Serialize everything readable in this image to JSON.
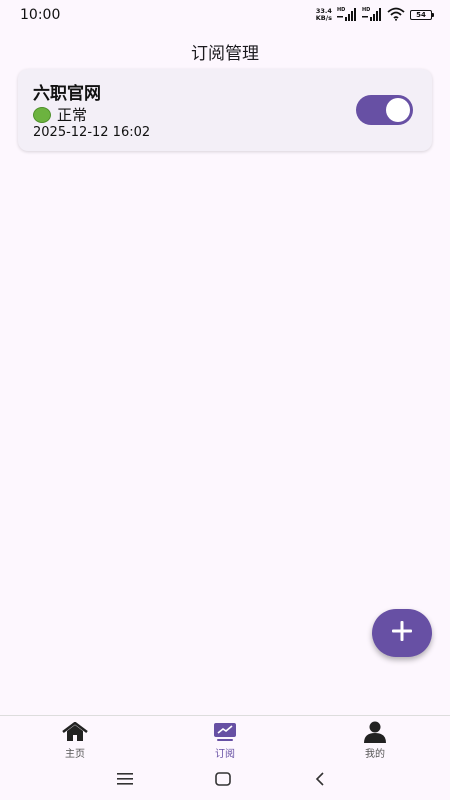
{
  "status_bar": {
    "time": "10:00",
    "net_speed_value": "33.4",
    "net_speed_unit": "KB/s",
    "signal_label": "HD",
    "battery": "54"
  },
  "header": {
    "title": "订阅管理"
  },
  "subscriptions": [
    {
      "name": "六职官网",
      "status": "正常",
      "status_color": "#6cb33f",
      "updated": "2025-12-12 16:02",
      "enabled": true
    }
  ],
  "colors": {
    "accent": "#6750a4",
    "background": "#fdf7fe",
    "card": "#f3eff7"
  },
  "fab": {
    "icon": "plus-icon"
  },
  "bottom_nav": {
    "items": [
      {
        "label": "主页",
        "icon": "home-icon",
        "active": false
      },
      {
        "label": "订阅",
        "icon": "subscription-icon",
        "active": true
      },
      {
        "label": "我的",
        "icon": "person-icon",
        "active": false
      }
    ]
  },
  "system_nav": {
    "icons": [
      "menu-icon",
      "home-square-icon",
      "back-icon"
    ]
  }
}
